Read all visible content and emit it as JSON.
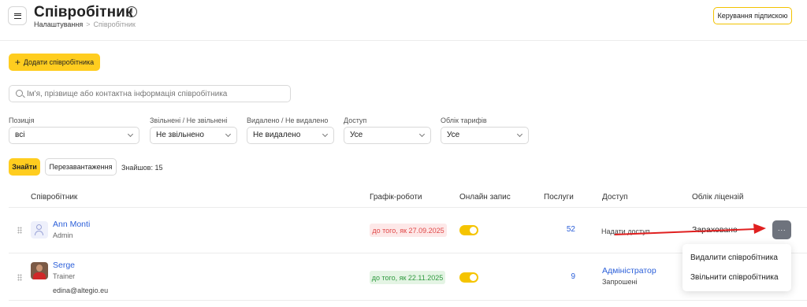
{
  "header": {
    "title": "Співробітник",
    "info_icon": "info-icon",
    "breadcrumb": {
      "parent": "Налаштування",
      "separator": ">",
      "current": "Співробітник"
    },
    "subscription_button": "Керування підпискою"
  },
  "toolbar": {
    "add_button_icon": "+",
    "add_button": "Додати співробітника"
  },
  "search": {
    "placeholder": "Ім'я, прізвище або контактна інформація співробітника",
    "value": ""
  },
  "filters": [
    {
      "label": "Позиція",
      "value": "всі"
    },
    {
      "label": "Звільнені / Не звільнені",
      "value": "Не звільнено"
    },
    {
      "label": "Видалено / Не видалено",
      "value": "Не видалено"
    },
    {
      "label": "Доступ",
      "value": "Усе"
    },
    {
      "label": "Облік тарифів",
      "value": "Усе"
    }
  ],
  "actions": {
    "find": "Знайти",
    "reload": "Перезавантаження",
    "found": "Знайшов: 15"
  },
  "table": {
    "columns": [
      "Співробітник",
      "Графік-роботи",
      "Онлайн запис",
      "Послуги",
      "Доступ",
      "Облік ліцензій"
    ],
    "rows": [
      {
        "name": "Ann Monti",
        "role": "Admin",
        "email": "",
        "schedule": "до того, як 27.09.2025",
        "schedule_status": "#e04848",
        "online_booking": true,
        "services": "52",
        "access": "Надати доступ",
        "access_sub": "",
        "license": "Зараховано"
      },
      {
        "name": "Serge",
        "role": "Trainer",
        "email": "edina@altegio.eu",
        "schedule": "до того, як 22.11.2025",
        "schedule_status": "#2f9a3f",
        "online_booking": true,
        "services": "9",
        "access": "Адміністратор",
        "access_sub": "Запрошені",
        "license": ""
      }
    ]
  },
  "row_menu": {
    "button": "···",
    "items": [
      "Видалити співробітника",
      "Звільнити співробітника"
    ]
  },
  "annotation": {
    "arrow_color": "#e02020"
  },
  "colors": {
    "accent": "#ffcd1f",
    "link": "#2b5fd9",
    "toggle_on": "#f5c400"
  }
}
